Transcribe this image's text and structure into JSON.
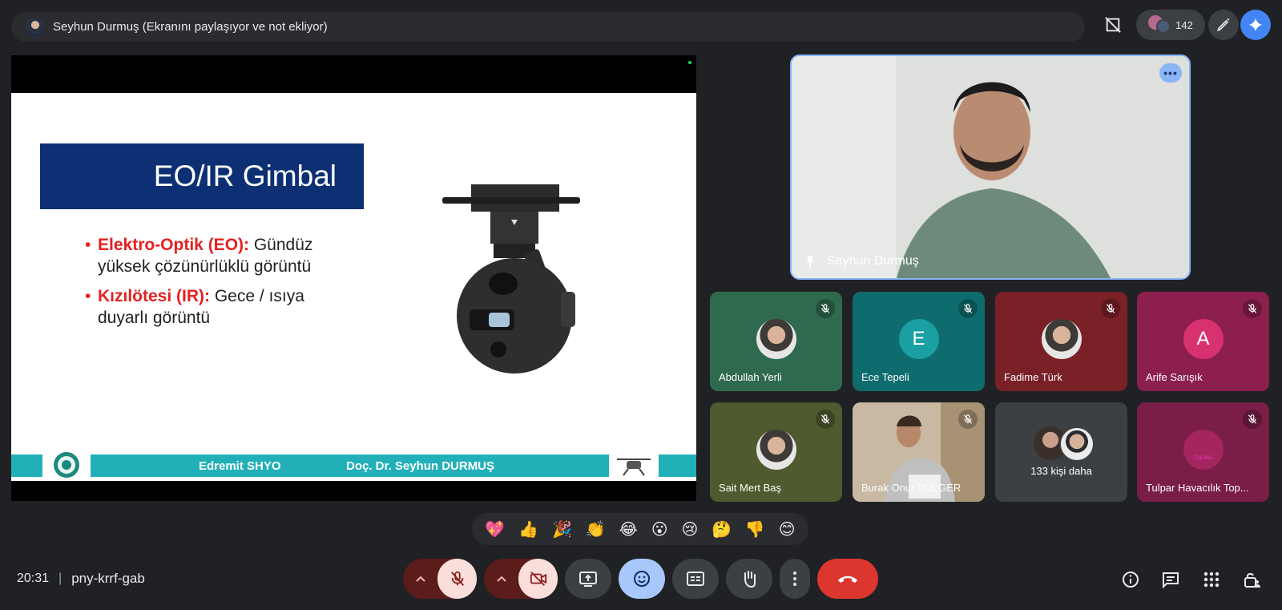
{
  "header": {
    "presenter_status": "Seyhun Durmuş (Ekranını paylaşıyor ve not ekliyor)",
    "participant_count": "142"
  },
  "slide": {
    "title": "EO/IR Gimbal",
    "bullet1_label": "Elektro-Optik (EO):",
    "bullet1_text": " Gündüz yüksek çözünürlüklü görüntü",
    "bullet2_label": "Kızılötesi (IR):",
    "bullet2_text": " Gece / ısıya duyarlı görüntü",
    "footer_left": "Edremit SHYO",
    "footer_right": "Doç. Dr. Seyhun DURMUŞ"
  },
  "main_video": {
    "name": "Seyhun Durmuş"
  },
  "participants": [
    {
      "name": "Abdullah Yerli",
      "bg": "#2f6a4f",
      "type": "photo"
    },
    {
      "name": "Ece Tepeli",
      "initial": "E",
      "bg": "#0e6c6f",
      "avatar_bg": "#1a9fa3",
      "type": "initial"
    },
    {
      "name": "Fadime Türk",
      "bg": "#7a2027",
      "type": "photo"
    },
    {
      "name": "Arife Sarışık",
      "initial": "A",
      "bg": "#8c1f4d",
      "avatar_bg": "#d8316f",
      "type": "initial"
    },
    {
      "name": "Sait Mert Baş",
      "bg": "#4f5a2e",
      "type": "photo"
    },
    {
      "name": "Burak Onur DÜLGER",
      "bg": "#b8a58f",
      "type": "video"
    },
    {
      "name": "133 kişi daha",
      "bg": "#3c4043",
      "type": "more"
    },
    {
      "name": "Tulpar Havacılık Top...",
      "bg": "#7a1e47",
      "type": "logo",
      "logo_text": "TULPAR"
    }
  ],
  "reactions": [
    "💖",
    "👍",
    "🎉",
    "👏",
    "😂",
    "😮",
    "😢",
    "🤔",
    "👎",
    "😊"
  ],
  "footer": {
    "time": "20:31",
    "separator": "|",
    "meeting_code": "pny-krrf-gab"
  },
  "colors": {
    "accent_blue": "#8ab4f8",
    "mic_off_bg": "#f9dedc",
    "hangup_red": "#dc362e",
    "muted_dark_red": "#6b1e1c"
  }
}
